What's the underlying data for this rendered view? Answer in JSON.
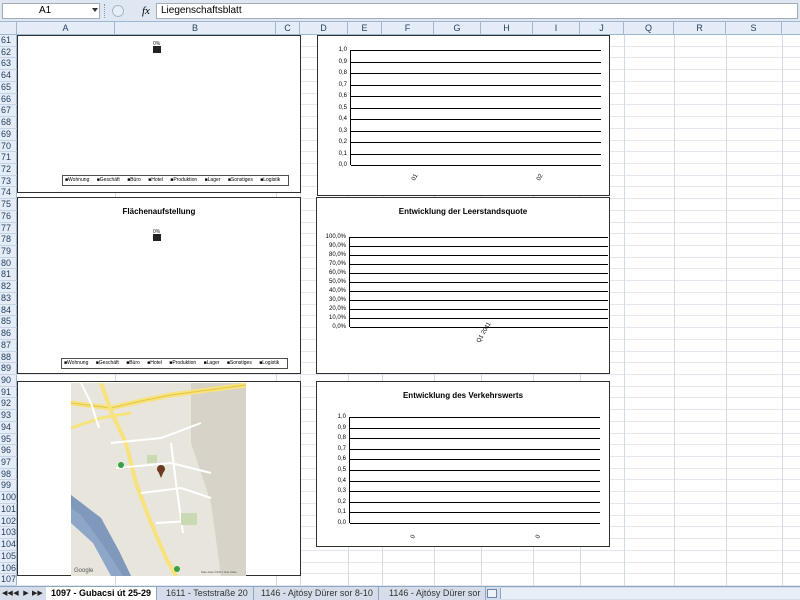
{
  "formula_bar": {
    "name_box": "A1",
    "fx_label": "fx",
    "formula": "Liegenschaftsblatt"
  },
  "columns": [
    "A",
    "B",
    "C",
    "D",
    "E",
    "F",
    "G",
    "H",
    "I",
    "J",
    "Q",
    "R",
    "S"
  ],
  "rows": [
    "61",
    "62",
    "63",
    "64",
    "65",
    "66",
    "67",
    "68",
    "69",
    "70",
    "71",
    "72",
    "73",
    "74",
    "75",
    "76",
    "77",
    "78",
    "79",
    "80",
    "81",
    "82",
    "83",
    "84",
    "85",
    "86",
    "87",
    "88",
    "89",
    "90",
    "91",
    "92",
    "93",
    "94",
    "95",
    "96",
    "97",
    "98",
    "99",
    "100",
    "101",
    "102",
    "103",
    "104",
    "105",
    "106",
    "107"
  ],
  "pie_chart_1": {
    "legend": [
      "Wohnung",
      "Geschäft",
      "Büro",
      "Hotel",
      "Produktion",
      "Lager",
      "Sonstiges",
      "Logistik"
    ]
  },
  "pie_chart_2": {
    "title": "Flächenaufstellung",
    "legend": [
      "Wohnung",
      "Geschäft",
      "Büro",
      "Hotel",
      "Produktion",
      "Lager",
      "Sonstiges",
      "Logistik"
    ]
  },
  "chart_data": [
    {
      "type": "line",
      "title": "",
      "y_ticks": [
        "1,0",
        "0,9",
        "0,8",
        "0,7",
        "0,6",
        "0,5",
        "0,4",
        "0,3",
        "0,2",
        "0,1",
        "0,0"
      ],
      "x_ticks": [
        "01",
        "02"
      ],
      "ylim": [
        0,
        1
      ],
      "grid": true
    },
    {
      "type": "line",
      "title": "Entwicklung der Leerstandsquote",
      "y_ticks": [
        "100,0%",
        "90,0%",
        "80,0%",
        "70,0%",
        "60,0%",
        "50,0%",
        "40,0%",
        "30,0%",
        "20,0%",
        "10,0%",
        "0,0%"
      ],
      "x_ticks": [
        "Q1 2011"
      ],
      "ylim": [
        0,
        100
      ],
      "grid": true
    },
    {
      "type": "line",
      "title": "Entwicklung des Verkehrswerts",
      "y_ticks": [
        "1,0",
        "0,9",
        "0,8",
        "0,7",
        "0,6",
        "0,5",
        "0,4",
        "0,3",
        "0,2",
        "0,1",
        "0,0"
      ],
      "x_ticks": [
        "0",
        "0"
      ],
      "ylim": [
        0,
        1
      ],
      "grid": true
    }
  ],
  "map": {
    "copyright": "Map data ©2011 Tele Atlas",
    "logo": "Google"
  },
  "sheet_tabs": [
    "1097 - Gubacsi út 25-29",
    "1611 - Teststraße 20",
    "1146 - Ajtósy Dürer sor 8-10",
    "1146 - Ajtósy Dürer sor"
  ],
  "tab_nav": [
    "◀◀",
    "◀",
    "▶",
    "▶▶"
  ],
  "colors": {
    "grid_line": "#d4dbe4",
    "header_bg": "#e4ecf7",
    "header_border": "#9eb6ce",
    "map_road": "#f7e27d"
  }
}
